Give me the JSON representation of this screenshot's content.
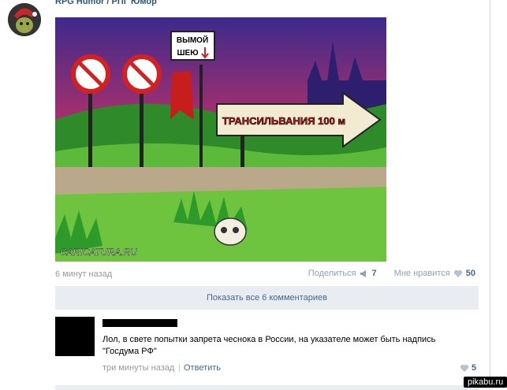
{
  "group": {
    "name": "RPG Humor / РПГ Юмор"
  },
  "post": {
    "time": "6 минут назад",
    "image": {
      "sign_top": "ВЫМОЙ",
      "sign_bottom": "ШЕЮ",
      "arrow_text": "ТРАНСИЛЬВАНИЯ 100 м",
      "credit": "CARICATURA.RU"
    },
    "share_label": "Поделиться",
    "share_count": "7",
    "like_label": "Мне нравится",
    "like_count": "50"
  },
  "comments": {
    "show_all_label": "Показать все 6 комментариев",
    "items": [
      {
        "text_line1": "Лол, в свете попытки запрета чеснока в России, на указателе может быть надпись",
        "text_line2": "\"Госдума РФ\"",
        "time": "три минуты назад",
        "reply_label": "Ответить",
        "likes": "5"
      }
    ]
  },
  "watermark": "pikabu.ru",
  "colors": {
    "link": "#45688e",
    "bar": "#e9edf1",
    "meta": "#999999"
  },
  "icons": [
    "megaphone-icon",
    "heart-icon"
  ]
}
